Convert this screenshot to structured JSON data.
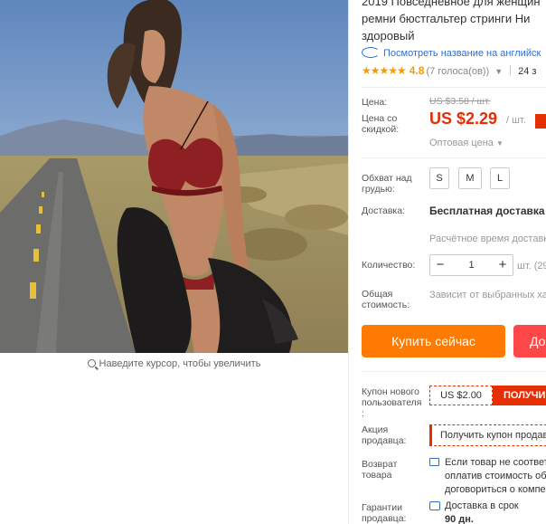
{
  "product": {
    "title_lines": [
      "2019 Повседневное для женщин",
      "ремни бюстгальтер стринги Ни",
      "здоровый"
    ],
    "translate_link": "Посмотреть название на английск",
    "rating": {
      "stars": "★★★★★",
      "score": "4.8",
      "votes": "(7 голоса(ов))",
      "orders": "24 з"
    }
  },
  "gallery": {
    "zoom_hint": "Наведите курсор, чтобы увеличить"
  },
  "price": {
    "label": "Цена:",
    "old": "US $3.58 / шт.",
    "discount_label": "Цена со скидкой:",
    "discount_label_lines": [
      "Цена со",
      "скидкой:"
    ],
    "new": "US $2.29",
    "unit": "/ шт.",
    "wholesale": "Оптовая цена"
  },
  "size": {
    "label_lines": [
      "Обхват над",
      "грудью:"
    ],
    "options": [
      "S",
      "M",
      "L"
    ]
  },
  "shipping": {
    "label": "Доставка:",
    "value": "Бесплатная доставка в I",
    "estimate": "Расчётное время доставк"
  },
  "quantity": {
    "label": "Количество:",
    "minus": "−",
    "value": "1",
    "plus": "+",
    "stock": "шт. (29"
  },
  "total": {
    "label_lines": [
      "Общая",
      "стоимость:"
    ],
    "value": "Зависит от выбранных ха"
  },
  "actions": {
    "buy_now": "Купить сейчас",
    "cart": "До"
  },
  "coupons": {
    "new_user_label_lines": [
      "Купон нового",
      "пользователя",
      ":"
    ],
    "new_user_value": "US $2.00",
    "new_user_button": "ПОЛУЧИ",
    "seller_label_lines": [
      "Акция",
      "продавца:"
    ],
    "seller_button": "Получить купон продав"
  },
  "returns": {
    "label_lines": [
      "Возврат",
      "товара"
    ],
    "text_lines": [
      "Если товар не соответ",
      "оплатив стоимость об",
      "договориться о компе"
    ]
  },
  "guarantee": {
    "label_lines": [
      "Гарантии",
      "продавца:"
    ],
    "text_lines": [
      "Доставка в срок",
      "90 дн."
    ]
  },
  "colors": {
    "accent_red": "#e62e04",
    "buy_orange": "#ff7a00",
    "cart_red": "#ff4747",
    "link_blue": "#2d6fd1",
    "star": "#f59b00"
  }
}
